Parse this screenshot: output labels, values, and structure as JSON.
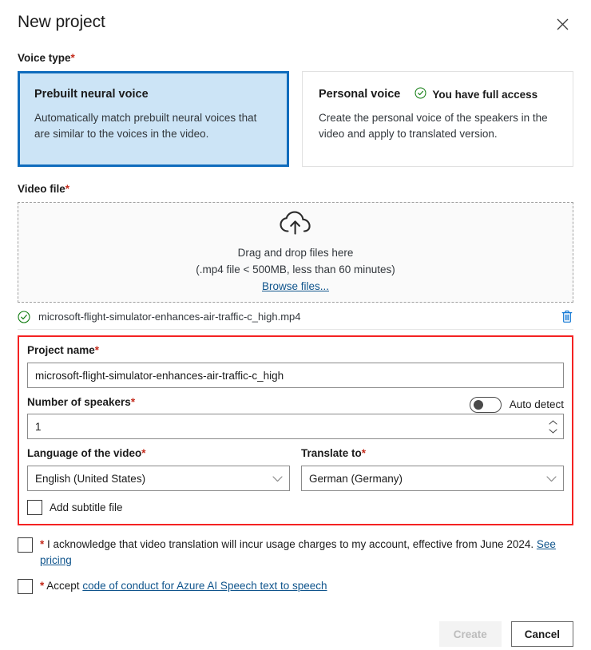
{
  "dialog": {
    "title": "New project",
    "close_icon": "close-icon"
  },
  "voice_type": {
    "label": "Voice type",
    "required_mark": "*",
    "options": [
      {
        "title": "Prebuilt neural voice",
        "description": "Automatically match prebuilt neural voices that are similar to the voices in the video.",
        "selected": true
      },
      {
        "title": "Personal voice",
        "description": "Create the personal voice of the speakers in the video and apply to translated version.",
        "badge": "You have full access",
        "badge_icon": "check-circle-icon",
        "selected": false
      }
    ]
  },
  "video_file": {
    "label": "Video file",
    "required_mark": "*",
    "dropzone": {
      "icon": "cloud-upload-icon",
      "primary": "Drag and drop files here",
      "secondary": "(.mp4 file < 500MB, less than 60 minutes)",
      "browse_link": "Browse files..."
    },
    "uploaded": {
      "status_icon": "check-circle-icon",
      "name": "microsoft-flight-simulator-enhances-air-traffic-c_high.mp4",
      "delete_icon": "trash-icon"
    }
  },
  "form": {
    "project_name": {
      "label": "Project name",
      "required_mark": "*",
      "value": "microsoft-flight-simulator-enhances-air-traffic-c_high"
    },
    "number_of_speakers": {
      "label": "Number of speakers",
      "required_mark": "*",
      "value": "1",
      "auto_detect_label": "Auto detect",
      "auto_detect_on": false
    },
    "language_of_video": {
      "label": "Language of the video",
      "required_mark": "*",
      "value": "English (United States)"
    },
    "translate_to": {
      "label": "Translate to",
      "required_mark": "*",
      "value": "German (Germany)"
    },
    "add_subtitle": {
      "label": "Add subtitle file",
      "checked": false
    }
  },
  "consents": [
    {
      "required_mark": "*",
      "text": "I acknowledge that video translation will incur usage charges to my account, effective from June 2024.",
      "link": "See pricing",
      "checked": false
    },
    {
      "required_mark": "*",
      "text": "Accept",
      "link": "code of conduct for Azure AI Speech text to speech",
      "checked": false
    }
  ],
  "footer": {
    "create_label": "Create",
    "create_disabled": true,
    "cancel_label": "Cancel"
  },
  "colors": {
    "accent_blue": "#0f6cbd",
    "card_selected_bg": "#cce4f6",
    "link_blue": "#0f548c",
    "required_red": "#c42b1c",
    "annotation_red": "#f42222",
    "success_green": "#107c10",
    "trash_blue": "#0f76d4"
  }
}
